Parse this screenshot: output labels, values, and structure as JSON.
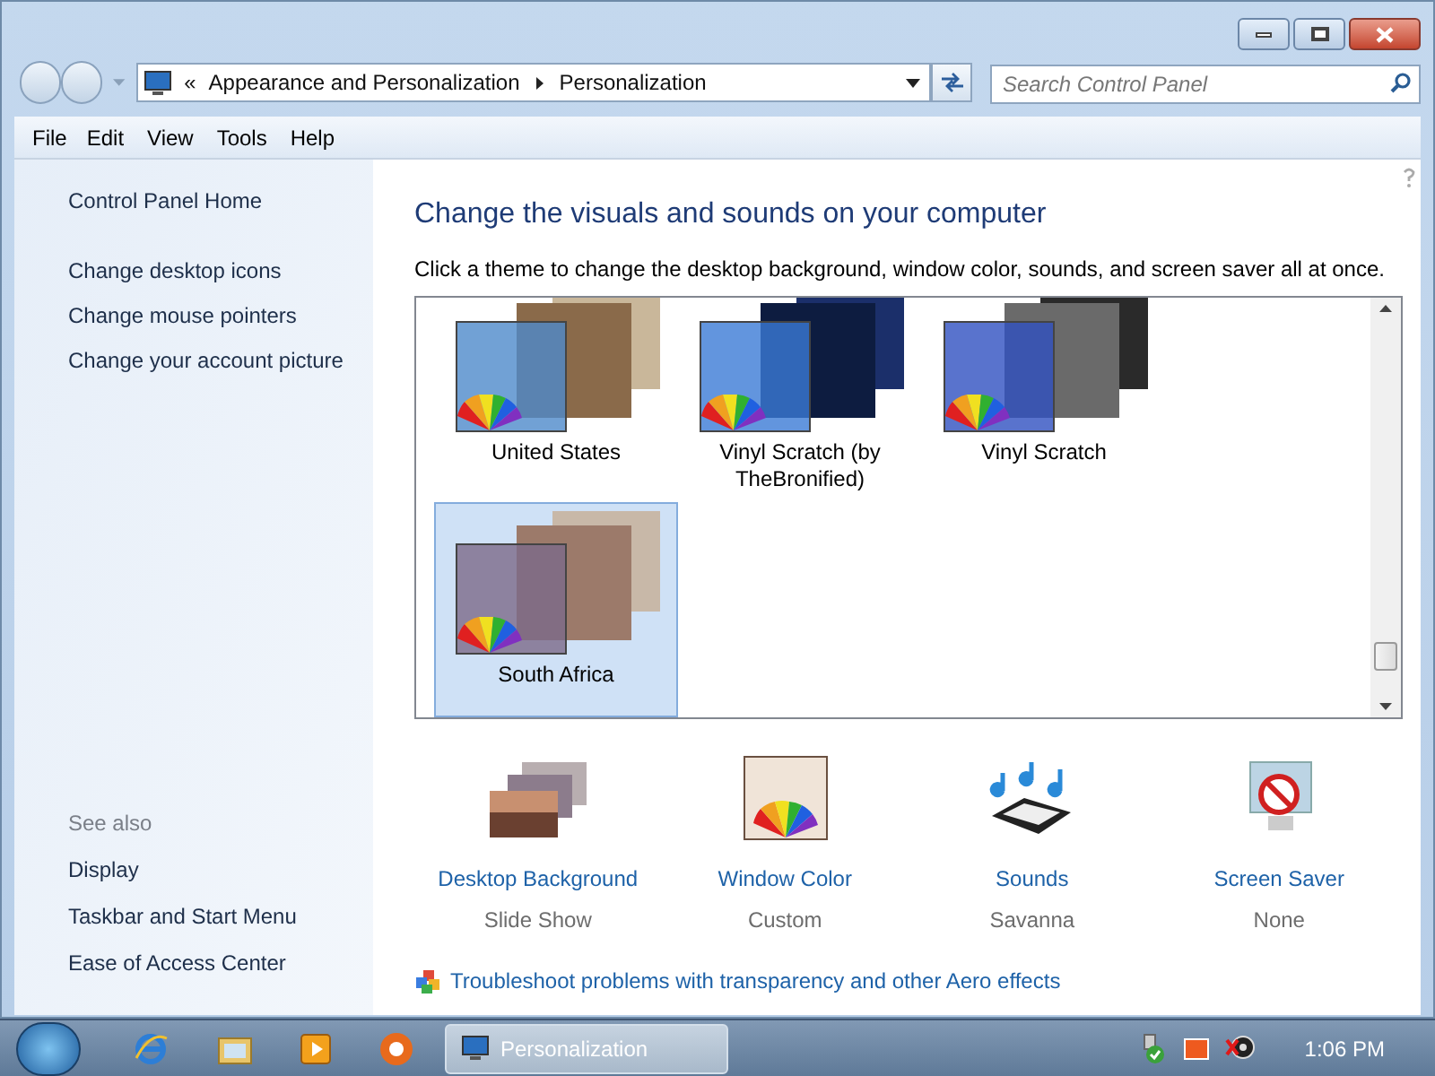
{
  "address_bar": {
    "overflow": "«",
    "breadcrumbs": [
      "Appearance and Personalization",
      "Personalization"
    ]
  },
  "search": {
    "placeholder": "Search Control Panel"
  },
  "menu": [
    "File",
    "Edit",
    "View",
    "Tools",
    "Help"
  ],
  "sidebar": {
    "home": "Control Panel Home",
    "tasks": [
      "Change desktop icons",
      "Change mouse pointers",
      "Change your account picture"
    ],
    "see_also_title": "See also",
    "see_also": [
      "Display",
      "Taskbar and Start Menu",
      "Ease of Access Center"
    ]
  },
  "main": {
    "heading": "Change the visuals and sounds on your computer",
    "description": "Click a theme to change the desktop background, window color, sounds, and screen saver all at once.",
    "themes": [
      {
        "name": "United States",
        "selected": false
      },
      {
        "name": "Vinyl Scratch (by TheBronified)",
        "selected": false
      },
      {
        "name": "Vinyl Scratch",
        "selected": false
      },
      {
        "name": "South Africa",
        "selected": true
      }
    ],
    "settings": [
      {
        "kind": "background",
        "label": "Desktop Background",
        "value": "Slide Show"
      },
      {
        "kind": "color",
        "label": "Window Color",
        "value": "Custom"
      },
      {
        "kind": "sounds",
        "label": "Sounds",
        "value": "Savanna"
      },
      {
        "kind": "screensaver",
        "label": "Screen Saver",
        "value": "None"
      }
    ],
    "troubleshoot": "Troubleshoot problems with transparency and other Aero effects"
  },
  "taskbar": {
    "window_button": "Personalization",
    "clock": "1:06 PM"
  }
}
